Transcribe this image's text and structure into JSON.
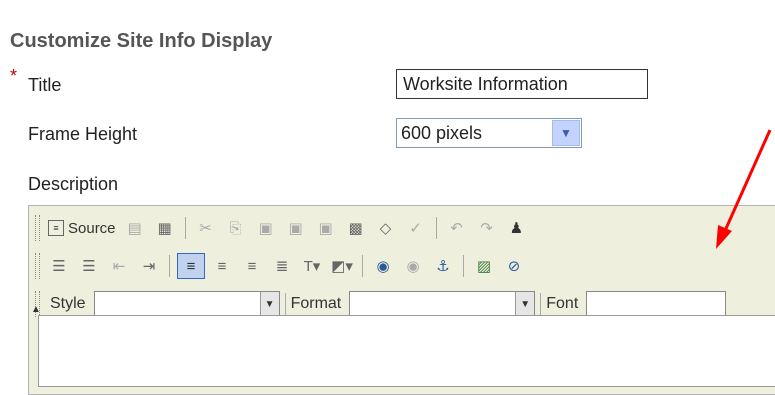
{
  "heading": "Customize Site Info Display",
  "required_mark": "*",
  "fields": {
    "title_label": "Title",
    "title_value": "Worksite Information",
    "frame_label": "Frame Height",
    "frame_value": "600 pixels",
    "description_label": "Description"
  },
  "toolbar": {
    "source_label": "Source",
    "style_label": "Style",
    "format_label": "Format",
    "font_label": "Font"
  },
  "annotation": {
    "arrow_color": "#ff0000"
  }
}
